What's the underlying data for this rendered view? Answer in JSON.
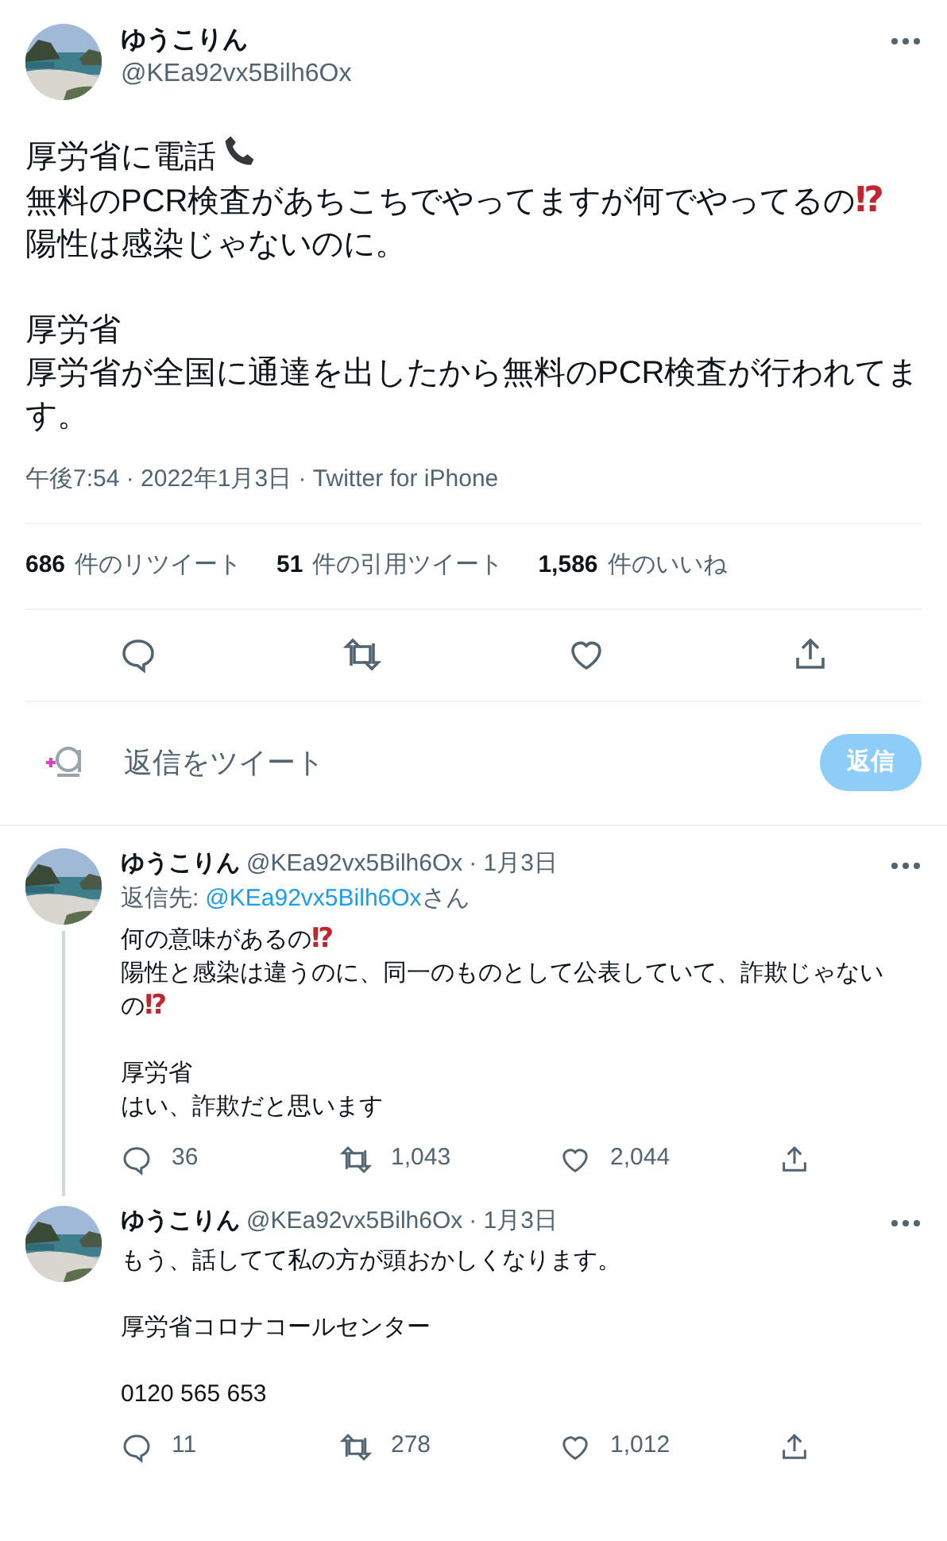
{
  "tweet": {
    "name": "ゆうこりん",
    "handle": "@KEa92vx5Bilh6Ox",
    "paragraphs": [
      [
        {
          "text": "厚労省に電話",
          "kind": "phone"
        },
        {
          "text": "無料のPCR検査があちこちでやってますが何でやってるの",
          "emoji": "⁉"
        },
        {
          "text": "陽性は感染じゃないのに。"
        }
      ],
      [
        {
          "text": "厚労省"
        },
        {
          "text": "厚労省が全国に通達を出したから無料のPCR検査が行われてます。"
        }
      ]
    ],
    "meta": "午後7:54 · 2022年1月3日 · Twitter for iPhone",
    "stats": [
      {
        "count": "686",
        "label": "件のリツイート"
      },
      {
        "count": "51",
        "label": "件の引用ツイート"
      },
      {
        "count": "1,586",
        "label": "件のいいね"
      }
    ]
  },
  "reply_box": {
    "placeholder": "返信をツイート",
    "button": "返信",
    "disabled": true
  },
  "replies": [
    {
      "name": "ゆうこりん",
      "handle": "@KEa92vx5Bilh6Ox",
      "date": "· 1月3日",
      "reply_to": {
        "prefix": "返信先:",
        "mention": "@KEa92vx5Bilh6Ox",
        "suffix": "さん"
      },
      "thread_line": true,
      "paragraphs": [
        [
          {
            "text": "何の意味があるの",
            "emoji": "⁉"
          },
          {
            "text": "陽性と感染は違うのに、同一のものとして公表していて、詐欺じゃないの",
            "emoji": "⁉"
          }
        ],
        [
          {
            "text": "厚労省"
          },
          {
            "text": "はい、詐欺だと思います"
          }
        ]
      ],
      "counts": {
        "reply": "36",
        "retweet": "1,043",
        "like": "2,044"
      }
    },
    {
      "name": "ゆうこりん",
      "handle": "@KEa92vx5Bilh6Ox",
      "date": "· 1月3日",
      "thread_line": false,
      "paragraphs": [
        [
          {
            "text": "もう、話してて私の方が頭おかしくなります。"
          }
        ],
        [
          {
            "text": "厚労省コロナコールセンター"
          }
        ],
        [
          {
            "text": "0120 565 653"
          }
        ]
      ],
      "counts": {
        "reply": "11",
        "retweet": "278",
        "like": "1,012"
      }
    }
  ]
}
